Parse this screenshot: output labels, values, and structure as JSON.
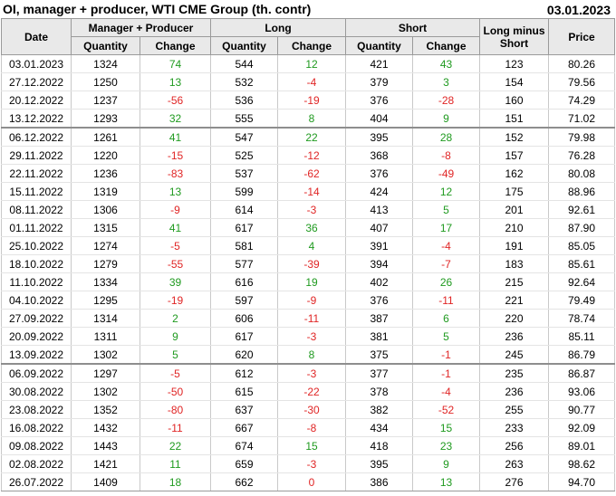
{
  "header": {
    "title": "OI, manager + producer, WTI CME Group (th. contr)",
    "date": "03.01.2023"
  },
  "columns": {
    "date": "Date",
    "mp": "Manager + Producer",
    "long": "Long",
    "short": "Short",
    "lms": "Long minus Short",
    "price": "Price",
    "quantity": "Quantity",
    "change": "Change"
  },
  "rows": [
    {
      "date": "03.01.2023",
      "mp_q": "1324",
      "mp_c": "74",
      "l_q": "544",
      "l_c": "12",
      "s_q": "421",
      "s_c": "43",
      "lms": "123",
      "price": "80.26"
    },
    {
      "date": "27.12.2022",
      "mp_q": "1250",
      "mp_c": "13",
      "l_q": "532",
      "l_c": "-4",
      "s_q": "379",
      "s_c": "3",
      "lms": "154",
      "price": "79.56"
    },
    {
      "date": "20.12.2022",
      "mp_q": "1237",
      "mp_c": "-56",
      "l_q": "536",
      "l_c": "-19",
      "s_q": "376",
      "s_c": "-28",
      "lms": "160",
      "price": "74.29"
    },
    {
      "date": "13.12.2022",
      "mp_q": "1293",
      "mp_c": "32",
      "l_q": "555",
      "l_c": "8",
      "s_q": "404",
      "s_c": "9",
      "lms": "151",
      "price": "71.02"
    },
    {
      "date": "06.12.2022",
      "mp_q": "1261",
      "mp_c": "41",
      "l_q": "547",
      "l_c": "22",
      "s_q": "395",
      "s_c": "28",
      "lms": "152",
      "price": "79.98"
    },
    {
      "date": "29.11.2022",
      "mp_q": "1220",
      "mp_c": "-15",
      "l_q": "525",
      "l_c": "-12",
      "s_q": "368",
      "s_c": "-8",
      "lms": "157",
      "price": "76.28"
    },
    {
      "date": "22.11.2022",
      "mp_q": "1236",
      "mp_c": "-83",
      "l_q": "537",
      "l_c": "-62",
      "s_q": "376",
      "s_c": "-49",
      "lms": "162",
      "price": "80.08"
    },
    {
      "date": "15.11.2022",
      "mp_q": "1319",
      "mp_c": "13",
      "l_q": "599",
      "l_c": "-14",
      "s_q": "424",
      "s_c": "12",
      "lms": "175",
      "price": "88.96"
    },
    {
      "date": "08.11.2022",
      "mp_q": "1306",
      "mp_c": "-9",
      "l_q": "614",
      "l_c": "-3",
      "s_q": "413",
      "s_c": "5",
      "lms": "201",
      "price": "92.61"
    },
    {
      "date": "01.11.2022",
      "mp_q": "1315",
      "mp_c": "41",
      "l_q": "617",
      "l_c": "36",
      "s_q": "407",
      "s_c": "17",
      "lms": "210",
      "price": "87.90"
    },
    {
      "date": "25.10.2022",
      "mp_q": "1274",
      "mp_c": "-5",
      "l_q": "581",
      "l_c": "4",
      "s_q": "391",
      "s_c": "-4",
      "lms": "191",
      "price": "85.05"
    },
    {
      "date": "18.10.2022",
      "mp_q": "1279",
      "mp_c": "-55",
      "l_q": "577",
      "l_c": "-39",
      "s_q": "394",
      "s_c": "-7",
      "lms": "183",
      "price": "85.61"
    },
    {
      "date": "11.10.2022",
      "mp_q": "1334",
      "mp_c": "39",
      "l_q": "616",
      "l_c": "19",
      "s_q": "402",
      "s_c": "26",
      "lms": "215",
      "price": "92.64"
    },
    {
      "date": "04.10.2022",
      "mp_q": "1295",
      "mp_c": "-19",
      "l_q": "597",
      "l_c": "-9",
      "s_q": "376",
      "s_c": "-11",
      "lms": "221",
      "price": "79.49"
    },
    {
      "date": "27.09.2022",
      "mp_q": "1314",
      "mp_c": "2",
      "l_q": "606",
      "l_c": "-11",
      "s_q": "387",
      "s_c": "6",
      "lms": "220",
      "price": "78.74"
    },
    {
      "date": "20.09.2022",
      "mp_q": "1311",
      "mp_c": "9",
      "l_q": "617",
      "l_c": "-3",
      "s_q": "381",
      "s_c": "5",
      "lms": "236",
      "price": "85.11"
    },
    {
      "date": "13.09.2022",
      "mp_q": "1302",
      "mp_c": "5",
      "l_q": "620",
      "l_c": "8",
      "s_q": "375",
      "s_c": "-1",
      "lms": "245",
      "price": "86.79"
    },
    {
      "date": "06.09.2022",
      "mp_q": "1297",
      "mp_c": "-5",
      "l_q": "612",
      "l_c": "-3",
      "s_q": "377",
      "s_c": "-1",
      "lms": "235",
      "price": "86.87"
    },
    {
      "date": "30.08.2022",
      "mp_q": "1302",
      "mp_c": "-50",
      "l_q": "615",
      "l_c": "-22",
      "s_q": "378",
      "s_c": "-4",
      "lms": "236",
      "price": "93.06"
    },
    {
      "date": "23.08.2022",
      "mp_q": "1352",
      "mp_c": "-80",
      "l_q": "637",
      "l_c": "-30",
      "s_q": "382",
      "s_c": "-52",
      "lms": "255",
      "price": "90.77"
    },
    {
      "date": "16.08.2022",
      "mp_q": "1432",
      "mp_c": "-11",
      "l_q": "667",
      "l_c": "-8",
      "s_q": "434",
      "s_c": "15",
      "lms": "233",
      "price": "92.09"
    },
    {
      "date": "09.08.2022",
      "mp_q": "1443",
      "mp_c": "22",
      "l_q": "674",
      "l_c": "15",
      "s_q": "418",
      "s_c": "23",
      "lms": "256",
      "price": "89.01"
    },
    {
      "date": "02.08.2022",
      "mp_q": "1421",
      "mp_c": "11",
      "l_q": "659",
      "l_c": "-3",
      "s_q": "395",
      "s_c": "9",
      "lms": "263",
      "price": "98.62"
    },
    {
      "date": "26.07.2022",
      "mp_q": "1409",
      "mp_c": "18",
      "l_q": "662",
      "l_c": "0",
      "s_q": "386",
      "s_c": "13",
      "lms": "276",
      "price": "94.70"
    }
  ],
  "block_starts": [
    4,
    17
  ],
  "colors": {
    "positive": "#1f9a1f",
    "negative": "#e02525",
    "header_bg": "#e9e9e9"
  }
}
